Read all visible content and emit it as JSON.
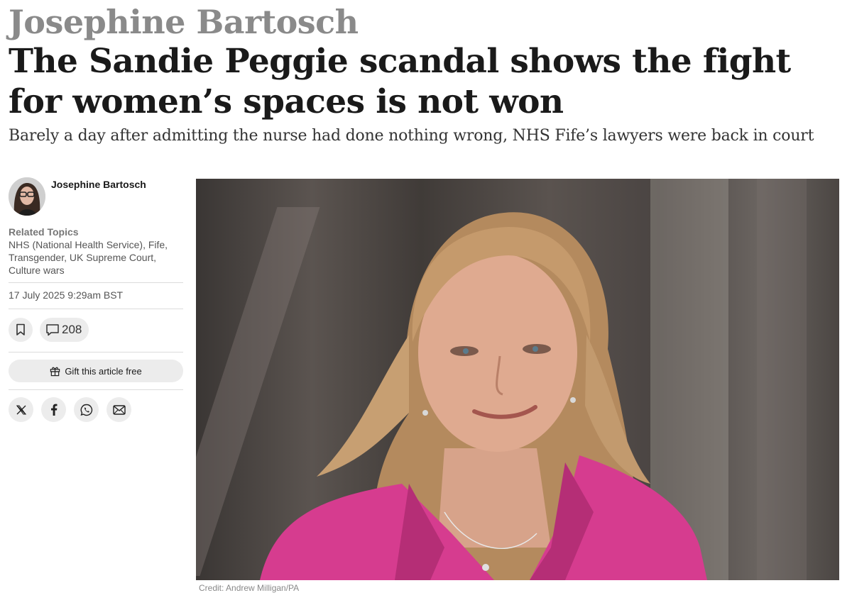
{
  "article": {
    "kicker": "Josephine Bartosch",
    "headline": "The Sandie Peggie scandal shows the fight for women’s spaces is not won",
    "standfirst": "Barely a day after admitting the nurse had done nothing wrong, NHS Fife’s lawyers were back in court",
    "image_credit": "Credit: Andrew Milligan/PA"
  },
  "sidebar": {
    "author_name": "Josephine Bartosch",
    "related_title": "Related Topics",
    "related_topics": "NHS (National Health Service), Fife, Transgender, UK Supreme Court, Culture wars",
    "date": "17 July 2025 9:29am BST",
    "comment_count": "208",
    "gift_label": "Gift this article free"
  },
  "icons": {
    "bookmark": "bookmark-icon",
    "comment": "comment-icon",
    "gift": "gift-icon",
    "share": [
      "x-icon",
      "facebook-icon",
      "whatsapp-icon",
      "email-icon"
    ]
  },
  "colors": {
    "kicker": "#8a8a8a",
    "headline": "#1a1a1a",
    "button_bg": "#ececec",
    "jacket": "#d63c8f"
  }
}
